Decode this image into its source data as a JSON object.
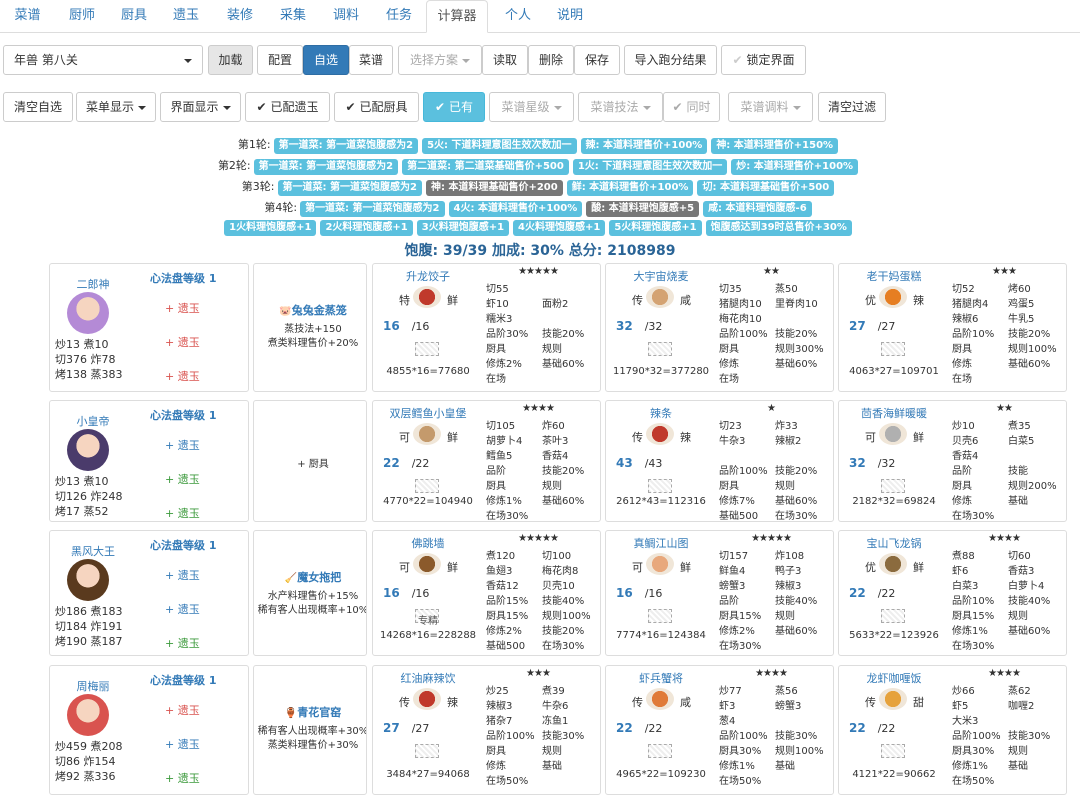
{
  "tabs": [
    "菜谱",
    "厨师",
    "厨具",
    "遗玉",
    "装修",
    "采集",
    "调料",
    "任务",
    "计算器",
    "个人",
    "说明"
  ],
  "active_tab": "计算器",
  "toolbar1": {
    "stage": "年兽 第八关",
    "load": "加载",
    "config": "配置",
    "custom": "自选",
    "recipes": "菜谱",
    "plan_placeholder": "选择方案",
    "read": "读取",
    "delete": "删除",
    "save": "保存",
    "import": "导入跑分结果",
    "lock": "锁定界面"
  },
  "toolbar2": {
    "clear": "清空自选",
    "menu_show": "菜单显示",
    "ui_show": "界面显示",
    "gem_assigned": "已配遗玉",
    "equip_assigned": "已配厨具",
    "have": "已有",
    "rec_star": "菜谱星级",
    "rec_skill": "菜谱技法",
    "same": "同时",
    "rec_season": "菜谱调料",
    "clear_filter": "清空过滤"
  },
  "rounds": [
    {
      "label": "第1轮:",
      "badges": [
        {
          "t": "第一道菜: 第一道菜饱腹感为2",
          "c": "light"
        },
        {
          "t": "5火: 下道料理意图生效次数加一",
          "c": "light"
        },
        {
          "t": "辣: 本道料理售价+100%",
          "c": "light"
        },
        {
          "t": "神: 本道料理售价+150%",
          "c": "light"
        }
      ]
    },
    {
      "label": "第2轮:",
      "badges": [
        {
          "t": "第一道菜: 第一道菜饱腹感为2",
          "c": "light"
        },
        {
          "t": "第二道菜: 第二道菜基础售价+500",
          "c": "light"
        },
        {
          "t": "1火: 下道料理意图生效次数加一",
          "c": "light"
        },
        {
          "t": "炒: 本道料理售价+100%",
          "c": "light"
        }
      ]
    },
    {
      "label": "第3轮:",
      "badges": [
        {
          "t": "第一道菜: 第一道菜饱腹感为2",
          "c": "light"
        },
        {
          "t": "神: 本道料理基础售价+200",
          "c": "dark"
        },
        {
          "t": "鲜: 本道料理售价+100%",
          "c": "light"
        },
        {
          "t": "切: 本道料理基础售价+500",
          "c": "light"
        }
      ]
    },
    {
      "label": "第4轮:",
      "badges": [
        {
          "t": "第一道菜: 第一道菜饱腹感为2",
          "c": "light"
        },
        {
          "t": "4火: 本道料理售价+100%",
          "c": "light"
        },
        {
          "t": "酸: 本道料理饱腹感+5",
          "c": "dark"
        },
        {
          "t": "咸: 本道料理饱腹感-6",
          "c": "light"
        }
      ]
    },
    {
      "label": "",
      "badges": [
        {
          "t": "1火料理饱腹感+1",
          "c": "light"
        },
        {
          "t": "2火料理饱腹感+1",
          "c": "light"
        },
        {
          "t": "3火料理饱腹感+1",
          "c": "light"
        },
        {
          "t": "4火料理饱腹感+1",
          "c": "light"
        },
        {
          "t": "5火料理饱腹感+1",
          "c": "light"
        },
        {
          "t": "饱腹感达到39时总售价+30%",
          "c": "light"
        }
      ]
    }
  ],
  "summary": "饱腹: 39/39 加成: 30% 总分: 2108989",
  "rows": [
    {
      "chef": {
        "name": "二郎神",
        "stats": [
          "炒13 煮10",
          "切376 炸78",
          "烤138 蒸383"
        ],
        "level": "心法盘等级 1",
        "gems": [
          {
            "t": "+ 遗玉",
            "c": "red"
          },
          {
            "t": "+ 遗玉",
            "c": "red"
          },
          {
            "t": "+ 遗玉",
            "c": "red"
          }
        ],
        "color": "#b48ad6"
      },
      "equip": {
        "name": "兔兔金蒸笼",
        "lines": [
          "蒸技法+150",
          "煮类料理售价+20%"
        ],
        "icon": "🐷"
      },
      "recipes": [
        {
          "name": "升龙饺子",
          "stars": "★★★★★",
          "rank": "特",
          "taste": "鲜",
          "qty": "16",
          "max": "/16",
          "score": "4855*16=77680",
          "cells": [
            [
              "切55",
              ""
            ],
            [
              "虾10",
              "面粉2"
            ],
            [
              "糯米3",
              ""
            ],
            [
              "品阶30%",
              "技能20%"
            ],
            [
              "厨具",
              "规则"
            ],
            [
              "修炼2%",
              "基础60%"
            ],
            [
              "在场",
              ""
            ]
          ],
          "color": "#c0392b"
        },
        {
          "name": "大宇宙烧麦",
          "stars": "★★",
          "rank": "传",
          "taste": "咸",
          "qty": "32",
          "max": "/32",
          "score": "11790*32=377280",
          "cells": [
            [
              "切35",
              "蒸50"
            ],
            [
              "猪腿肉10",
              "里脊肉10"
            ],
            [
              "梅花肉10",
              ""
            ],
            [
              "品阶100%",
              "技能20%"
            ],
            [
              "厨具",
              "规则300%"
            ],
            [
              "修炼",
              "基础60%"
            ],
            [
              "在场",
              ""
            ]
          ],
          "color": "#d4a373"
        },
        {
          "name": "老干妈蛋糕",
          "stars": "★★★",
          "rank": "优",
          "taste": "辣",
          "qty": "27",
          "max": "/27",
          "score": "4063*27=109701",
          "cells": [
            [
              "切52",
              "烤60"
            ],
            [
              "猪腿肉4",
              "鸡蛋5"
            ],
            [
              "辣椒6",
              "牛乳5"
            ],
            [
              "品阶10%",
              "技能20%"
            ],
            [
              "厨具",
              "规则100%"
            ],
            [
              "修炼",
              "基础60%"
            ],
            [
              "在场",
              ""
            ]
          ],
          "color": "#e67e22"
        }
      ]
    },
    {
      "chef": {
        "name": "小皇帝",
        "stats": [
          "炒13 煮10",
          "切126 炸248",
          "烤17 蒸52"
        ],
        "level": "心法盘等级 1",
        "gems": [
          {
            "t": "+ 遗玉",
            "c": "blue"
          },
          {
            "t": "+ 遗玉",
            "c": "green"
          },
          {
            "t": "+ 遗玉",
            "c": "green"
          }
        ],
        "color": "#4a3b6b"
      },
      "equip": {
        "name": "",
        "lines": [
          "+ 厨具"
        ],
        "icon": ""
      },
      "recipes": [
        {
          "name": "双层鳕鱼小皇堡",
          "stars": "★★★★",
          "rank": "可",
          "taste": "鲜",
          "qty": "22",
          "max": "/22",
          "score": "4770*22=104940",
          "cells": [
            [
              "切105",
              "炸60"
            ],
            [
              "胡萝卜4",
              "茶叶3"
            ],
            [
              "鳕鱼5",
              "香菇4"
            ],
            [
              "品阶",
              "技能20%"
            ],
            [
              "厨具",
              "规则"
            ],
            [
              "修炼1%",
              "基础60%"
            ],
            [
              "在场30%",
              ""
            ]
          ],
          "color": "#c49a6c"
        },
        {
          "name": "辣条",
          "stars": "★",
          "rank": "传",
          "taste": "辣",
          "qty": "43",
          "max": "/43",
          "score": "2612*43=112316",
          "cells": [
            [
              "切23",
              "炸33"
            ],
            [
              "牛杂3",
              "辣椒2"
            ],
            [
              "",
              ""
            ],
            [
              "品阶100%",
              "技能20%"
            ],
            [
              "厨具",
              "规则"
            ],
            [
              "修炼7%",
              "基础60%"
            ],
            [
              "基础500",
              "在场30%"
            ]
          ],
          "color": "#c0392b"
        },
        {
          "name": "茴香海鲜暖暖",
          "stars": "★★",
          "rank": "可",
          "taste": "鲜",
          "qty": "32",
          "max": "/32",
          "score": "2182*32=69824",
          "cells": [
            [
              "炒10",
              "煮35"
            ],
            [
              "贝壳6",
              "白菜5"
            ],
            [
              "香菇4",
              ""
            ],
            [
              "品阶",
              "技能"
            ],
            [
              "厨具",
              "规则200%"
            ],
            [
              "修炼",
              "基础"
            ],
            [
              "在场30%",
              ""
            ]
          ],
          "color": "#b0b0b0"
        }
      ]
    },
    {
      "chef": {
        "name": "黑风大王",
        "stats": [
          "炒186 煮183",
          "切184 炸191",
          "烤190 蒸187"
        ],
        "level": "心法盘等级 1",
        "gems": [
          {
            "t": "+ 遗玉",
            "c": "blue"
          },
          {
            "t": "+ 遗玉",
            "c": "blue"
          },
          {
            "t": "+ 遗玉",
            "c": "green"
          }
        ],
        "color": "#5a3a1e"
      },
      "equip": {
        "name": "魔女拖把",
        "lines": [
          "水产料理售价+15%",
          "稀有客人出现概率+10%"
        ],
        "icon": "🧹"
      },
      "recipes": [
        {
          "name": "佛跳墙",
          "stars": "★★★★★",
          "rank": "可",
          "taste": "鲜",
          "qty": "16",
          "max": "/16",
          "score": "14268*16=228288",
          "spec": "专精",
          "cells": [
            [
              "煮120",
              "切100"
            ],
            [
              "鱼翅3",
              "梅花肉8"
            ],
            [
              "香菇12",
              "贝壳10"
            ],
            [
              "品阶15%",
              "技能40%"
            ],
            [
              "厨具15%",
              "规则100%"
            ],
            [
              "修炼2%",
              "技能20%"
            ],
            [
              "基础500",
              "在场30%"
            ]
          ],
          "color": "#8b5a2b"
        },
        {
          "name": "真鲷江山图",
          "stars": "★★★★★",
          "rank": "可",
          "taste": "鲜",
          "qty": "16",
          "max": "/16",
          "score": "7774*16=124384",
          "cells": [
            [
              "切157",
              "炸108"
            ],
            [
              "鲜鱼4",
              "鸭子3"
            ],
            [
              "螃蟹3",
              "辣椒3"
            ],
            [
              "品阶",
              "技能40%"
            ],
            [
              "厨具15%",
              "规则"
            ],
            [
              "修炼2%",
              "基础60%"
            ],
            [
              "在场30%",
              ""
            ]
          ],
          "color": "#e8a87c"
        },
        {
          "name": "宝山飞龙锅",
          "stars": "★★★★",
          "rank": "优",
          "taste": "鲜",
          "qty": "22",
          "max": "/22",
          "score": "5633*22=123926",
          "cells": [
            [
              "煮88",
              "切60"
            ],
            [
              "虾6",
              "香菇3"
            ],
            [
              "白菜3",
              "白萝卜4"
            ],
            [
              "品阶10%",
              "技能40%"
            ],
            [
              "厨具15%",
              "规则"
            ],
            [
              "修炼1%",
              "基础60%"
            ],
            [
              "在场30%",
              ""
            ]
          ],
          "color": "#8b6b3e"
        }
      ]
    },
    {
      "chef": {
        "name": "周梅丽",
        "stats": [
          "炒459 煮208",
          "切86 炸154",
          "烤92 蒸336"
        ],
        "level": "心法盘等级 1",
        "gems": [
          {
            "t": "+ 遗玉",
            "c": "red"
          },
          {
            "t": "+ 遗玉",
            "c": "blue"
          },
          {
            "t": "+ 遗玉",
            "c": "green"
          }
        ],
        "color": "#d9534f"
      },
      "equip": {
        "name": "青花官窑",
        "lines": [
          "稀有客人出现概率+30%",
          "蒸类料理售价+30%"
        ],
        "icon": "🏺"
      },
      "recipes": [
        {
          "name": "红油麻辣饮",
          "stars": "★★★",
          "rank": "传",
          "taste": "辣",
          "qty": "27",
          "max": "/27",
          "score": "3484*27=94068",
          "cells": [
            [
              "炒25",
              "煮39"
            ],
            [
              "辣椒3",
              "牛杂6"
            ],
            [
              "猪杂7",
              "冻鱼1"
            ],
            [
              "品阶100%",
              "技能30%"
            ],
            [
              "厨具",
              "规则"
            ],
            [
              "修炼",
              "基础"
            ],
            [
              "在场50%",
              ""
            ]
          ],
          "color": "#c0392b"
        },
        {
          "name": "虾兵蟹将",
          "stars": "★★★★",
          "rank": "传",
          "taste": "咸",
          "qty": "22",
          "max": "/22",
          "score": "4965*22=109230",
          "cells": [
            [
              "炒77",
              "蒸56"
            ],
            [
              "虾3",
              "螃蟹3"
            ],
            [
              "葱4",
              ""
            ],
            [
              "品阶100%",
              "技能30%"
            ],
            [
              "厨具30%",
              "规则100%"
            ],
            [
              "修炼1%",
              "基础"
            ],
            [
              "在场50%",
              ""
            ]
          ],
          "color": "#e07b39"
        },
        {
          "name": "龙虾咖喱饭",
          "stars": "★★★★",
          "rank": "传",
          "taste": "甜",
          "qty": "22",
          "max": "/22",
          "score": "4121*22=90662",
          "cells": [
            [
              "炒66",
              "蒸62"
            ],
            [
              "虾5",
              "咖喱2"
            ],
            [
              "大米3",
              ""
            ],
            [
              "品阶100%",
              "技能30%"
            ],
            [
              "厨具30%",
              "规则"
            ],
            [
              "修炼1%",
              "基础"
            ],
            [
              "在场50%",
              ""
            ]
          ],
          "color": "#e6a23c"
        }
      ]
    }
  ]
}
